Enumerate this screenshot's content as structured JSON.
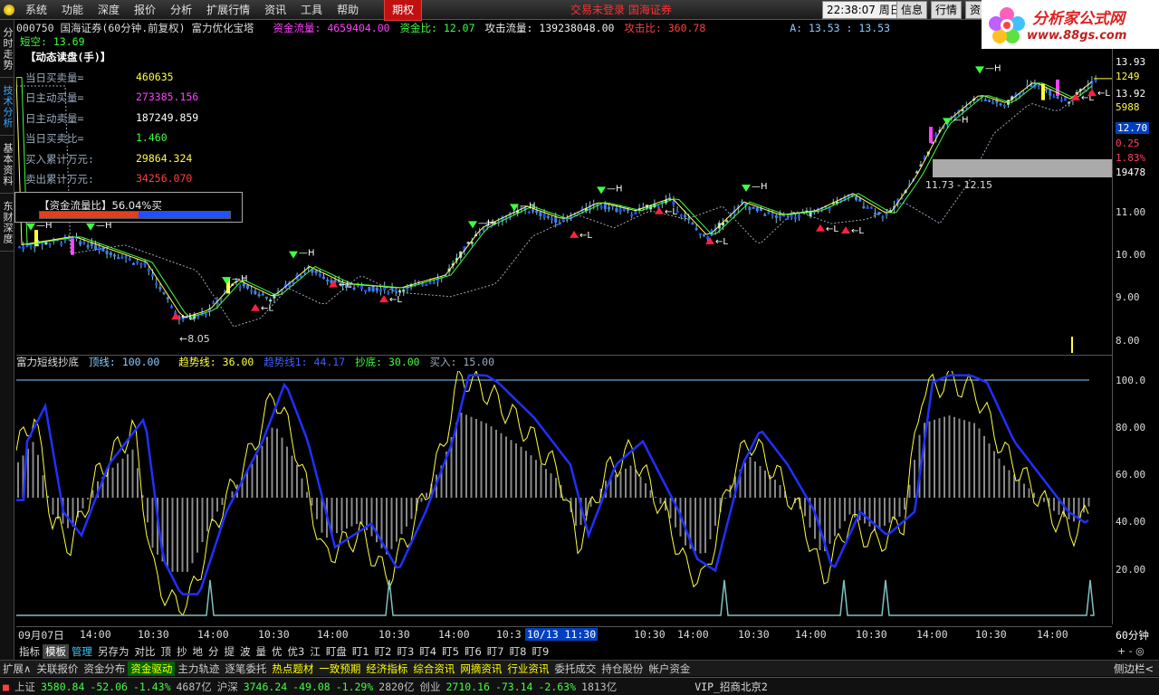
{
  "menu": [
    "系统",
    "功能",
    "深度",
    "报价",
    "分析",
    "扩展行情",
    "资讯",
    "工具",
    "帮助"
  ],
  "menu_active": "期权",
  "trade_status": "交易未登录  国海证券",
  "clock": "22:38:07 周日",
  "top_buttons": [
    "信息",
    "行情",
    "资"
  ],
  "brand": {
    "title": "分析家公式网",
    "url": "www.88gs.com"
  },
  "left_tabs": [
    "分时走势",
    "技术分析",
    "基本资料",
    "东财深度"
  ],
  "info": {
    "stock": "000750 国海证券(60分钟.前复权) 富力优化宝塔",
    "flow_label": "资金流量:",
    "flow_value": "4659404.00",
    "ratio_label": "资金比:",
    "ratio_value": "12.07",
    "attack_flow_label": "攻击流量:",
    "attack_flow_value": "139238048.00",
    "attack_ratio_label": "攻击比:",
    "attack_ratio_value": "360.78",
    "a_value": "A: 13.53 : 13.53",
    "short_label": "短空:",
    "short_value": "13.69"
  },
  "panel": {
    "title": "【动态读盘(手)】",
    "rows": [
      {
        "label": "当日买卖量=",
        "value": "460635",
        "color": "#ffff40"
      },
      {
        "label": "日主动买量=",
        "value": "273385.156",
        "color": "#ff40ff"
      },
      {
        "label": "日主动卖量=",
        "value": "187249.859",
        "color": "#ffffff"
      },
      {
        "label": "当日买卖比=",
        "value": "1.460",
        "color": "#40ff40"
      },
      {
        "label": "买入累计万元:",
        "value": "29864.324",
        "color": "#ffff40"
      },
      {
        "label": "卖出累计万元:",
        "value": "34256.070",
        "color": "#ff4040"
      }
    ],
    "flow_title": "【资金流量比】56.04%买",
    "flow_buy_pct": 56.04
  },
  "main_axis": [
    "13.93",
    "1249",
    "13.92",
    "5988",
    "12.70",
    "0.25",
    "1.83%",
    "19478",
    "11.00",
    "10.00",
    "9.00",
    "8.00"
  ],
  "annotations": {
    "low": "←8.05",
    "range": "11.73 - 12.15",
    "marker_h": "—H",
    "marker_l": "←L"
  },
  "lower": {
    "name": "富力短线抄底",
    "top_label": "顶线:",
    "top_value": "100.00",
    "trend_label": "趋势线:",
    "trend_value": "36.00",
    "trend1_label": "趋势线1:",
    "trend1_value": "44.17",
    "bottom_label": "抄底:",
    "bottom_value": "30.00",
    "buy_label": "买入:",
    "buy_value": "15.00",
    "axis": [
      "100.0",
      "80.00",
      "60.00",
      "40.00",
      "20.00"
    ]
  },
  "x_axis": [
    "09月07日",
    "14:00",
    "10:30",
    "14:00",
    "10:30",
    "14:00",
    "10:30",
    "14:00",
    "10:3",
    "10/13 11:30",
    "10:30",
    "14:00",
    "10:30",
    "14:00",
    "10:30",
    "14:00",
    "10:30",
    "14:00"
  ],
  "x_period": "60分钟",
  "toolbar2": [
    "指标",
    "模板",
    "管理",
    "另存为",
    "对比",
    "顶",
    "抄",
    "地",
    "分",
    "提",
    "波",
    "量",
    "优",
    "优3",
    "江",
    "盯盘",
    "盯1",
    "盯2",
    "盯3",
    "盯4",
    "盯5",
    "盯6",
    "盯7",
    "盯8",
    "盯9"
  ],
  "toolbar2_right": "+ - ◎",
  "tabs3": [
    "扩展∧",
    "关联报价",
    "资金分布",
    "资金驱动",
    "主力轨迹",
    "逐笔委托",
    "热点题材",
    "一致预期",
    "经济指标",
    "综合资讯",
    "网摘资讯",
    "行业资讯",
    "委托成交",
    "持仓股份",
    "帐户资金"
  ],
  "tabs3_right": "侧边栏<",
  "status": {
    "sh_label": "上证",
    "sh_val": "3580.84",
    "sh_chg": "-52.06",
    "sh_pct": "-1.43%",
    "sh_amt": "4687亿",
    "hs_label": "沪深",
    "hs_val": "3746.24",
    "hs_chg": "-49.08",
    "hs_pct": "-1.29%",
    "hs_amt": "2820亿",
    "cy_label": "创业",
    "cy_val": "2710.16",
    "cy_chg": "-73.14",
    "cy_pct": "-2.63%",
    "cy_amt": "1813亿",
    "vip": "VIP_招商北京2"
  }
}
